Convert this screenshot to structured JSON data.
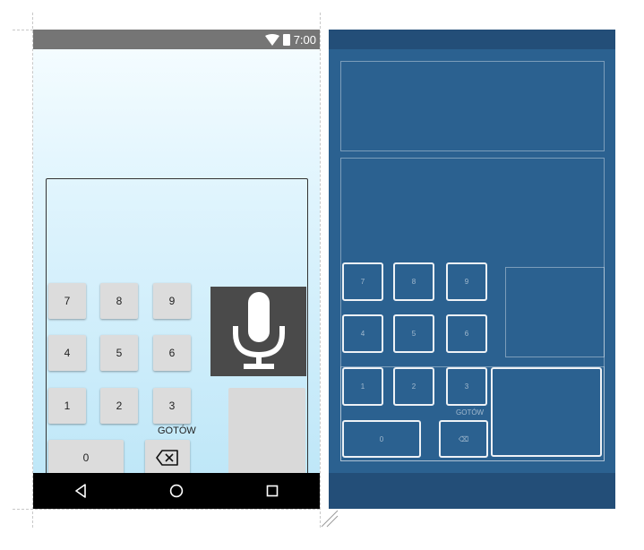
{
  "status_bar": {
    "time": "7:00",
    "wifi_icon": "wifi-icon",
    "battery_icon": "battery-icon"
  },
  "keypad": {
    "keys": [
      "7",
      "8",
      "9",
      "4",
      "5",
      "6",
      "1",
      "2",
      "3",
      "0"
    ],
    "ok_label": "GOTÓW",
    "backspace_icon": "backspace-icon",
    "mic_icon": "microphone-icon"
  },
  "nav_bar": {
    "back_icon": "back-triangle-icon",
    "home_icon": "home-circle-icon",
    "recents_icon": "recents-square-icon"
  },
  "blueprint": {
    "keys": [
      "7",
      "8",
      "9",
      "4",
      "5",
      "6",
      "1",
      "2",
      "3",
      "0"
    ],
    "ok_label": "GOTÓW",
    "backspace_glyph": "⌫"
  },
  "colors": {
    "status_bar": "#757575",
    "screen_gradient_top": "#f4fcff",
    "screen_gradient_bottom": "#bfe7f8",
    "key_background": "#dcdcdc",
    "mic_tile": "#4a4a4a",
    "nav_bar": "#000000",
    "blueprint_background": "#2b6190",
    "blueprint_bars": "#234e78"
  }
}
